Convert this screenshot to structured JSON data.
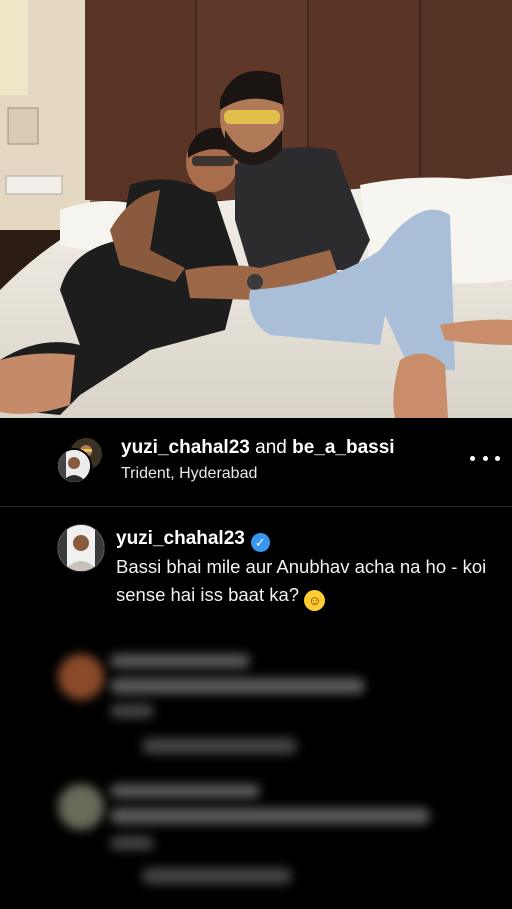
{
  "header": {
    "user1": "yuzi_chahal23",
    "conjunction": "and",
    "user2": "be_a_bassi",
    "location": "Trident, Hyderabad",
    "more_icon": "more-horizontal-icon"
  },
  "post": {
    "username": "yuzi_chahal23",
    "verified_icon": "verified-badge-icon",
    "caption": "Bassi bhai mile aur Anubhav acha na ho - koi sense hai iss baat ka?",
    "emoji_icon": "rolling-on-floor-laughing-emoji"
  },
  "colors": {
    "background": "#000000",
    "verified": "#3897f0",
    "divider": "#262626"
  }
}
